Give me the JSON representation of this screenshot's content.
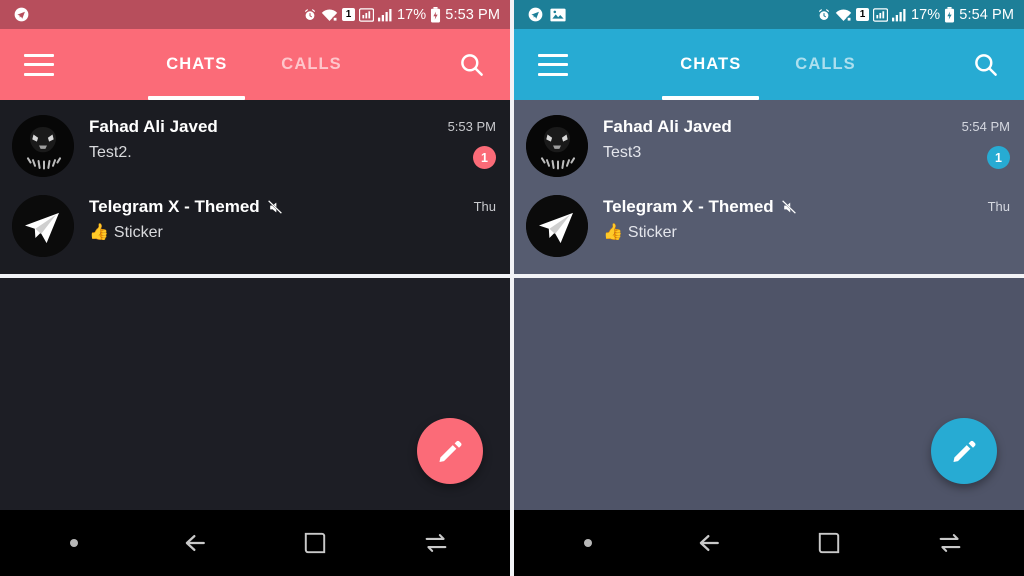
{
  "panels": [
    {
      "id": "left-pink-theme",
      "theme": {
        "accent": "#fb6b78",
        "status_bar_bg": "#b74e5c",
        "app_bar_bg": "#fb6b78",
        "list_bg": "#1b1c22",
        "empty_bg": "#1d1e25",
        "badge_bg": "#fb6b78",
        "title_color": "#ffffff",
        "preview_color": "#d9dadd",
        "time_color": "#c9cace"
      },
      "status": {
        "left_icons": [
          "telegram-icon"
        ],
        "right_icons": [
          "alarm-icon",
          "wifi-icon",
          "sim-badge-icon",
          "signal-strength-icon",
          "signal-bars-icon"
        ],
        "sim_label": "1",
        "battery_percent": "17%",
        "time": "5:53 PM"
      },
      "app_bar": {
        "menu_icon": "hamburger-icon",
        "tabs": [
          {
            "label": "CHATS",
            "active": true
          },
          {
            "label": "CALLS",
            "active": false
          }
        ],
        "search_icon": "search-icon"
      },
      "chats": [
        {
          "avatar": "black-panther-avatar",
          "title": "Fahad Ali Javed",
          "muted": false,
          "preview": "Test2.",
          "preview_emoji": "",
          "time": "5:53 PM",
          "unread": "1"
        },
        {
          "avatar": "telegram-avatar",
          "title": "Telegram X - Themed",
          "muted": true,
          "preview": "Sticker",
          "preview_emoji": "👍",
          "time": "Thu",
          "unread": ""
        }
      ],
      "fab": {
        "icon": "pencil-compose-icon"
      },
      "nav_bar": {
        "buttons": [
          {
            "icon": "dot-indicator-icon"
          },
          {
            "icon": "back-arrow-icon"
          },
          {
            "icon": "home-square-icon"
          },
          {
            "icon": "recents-swap-icon"
          }
        ]
      }
    },
    {
      "id": "right-blue-theme",
      "theme": {
        "accent": "#27abd3",
        "status_bar_bg": "#1d7f98",
        "app_bar_bg": "#27abd3",
        "list_bg": "#565c70",
        "empty_bg": "#4f5468",
        "badge_bg": "#27abd3",
        "title_color": "#ffffff",
        "preview_color": "#e4e6ec",
        "time_color": "#d5d8e0"
      },
      "status": {
        "left_icons": [
          "telegram-icon",
          "gallery-image-icon"
        ],
        "right_icons": [
          "alarm-icon",
          "wifi-icon",
          "sim-badge-icon",
          "signal-strength-icon",
          "signal-bars-icon"
        ],
        "sim_label": "1",
        "battery_percent": "17%",
        "time": "5:54 PM"
      },
      "app_bar": {
        "menu_icon": "hamburger-icon",
        "tabs": [
          {
            "label": "CHATS",
            "active": true
          },
          {
            "label": "CALLS",
            "active": false
          }
        ],
        "search_icon": "search-icon"
      },
      "chats": [
        {
          "avatar": "black-panther-avatar",
          "title": "Fahad Ali Javed",
          "muted": false,
          "preview": "Test3",
          "preview_emoji": "",
          "time": "5:54 PM",
          "unread": "1"
        },
        {
          "avatar": "telegram-avatar",
          "title": "Telegram X - Themed",
          "muted": true,
          "preview": "Sticker",
          "preview_emoji": "👍",
          "time": "Thu",
          "unread": ""
        }
      ],
      "fab": {
        "icon": "pencil-compose-icon"
      },
      "nav_bar": {
        "buttons": [
          {
            "icon": "dot-indicator-icon"
          },
          {
            "icon": "back-arrow-icon"
          },
          {
            "icon": "home-square-icon"
          },
          {
            "icon": "recents-swap-icon"
          }
        ]
      }
    }
  ]
}
